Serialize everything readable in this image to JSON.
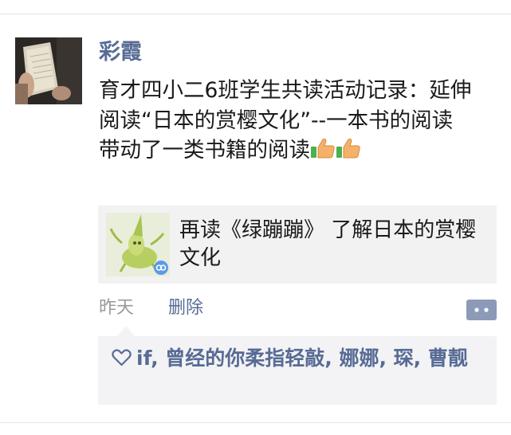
{
  "post": {
    "author": "彩霞",
    "text": "育才四小二6班学生共读活动记录：延伸阅读“日本的赏樱文化”--一本书的阅读带动了一类书籍的阅读",
    "emoji": [
      "thumbs-up-icon",
      "thumbs-up-icon"
    ],
    "link": {
      "title": "再读《绿蹦蹦》 了解日本的赏樱文化"
    },
    "time": "昨天",
    "delete_label": "删除"
  },
  "likes": {
    "names": "if, 曾经的你柔指轻敲, 娜娜, 琛, 曹靓"
  },
  "colors": {
    "name_link": "#576b95",
    "meta_gray": "#999999",
    "panel_bg": "#f3f3f5"
  }
}
